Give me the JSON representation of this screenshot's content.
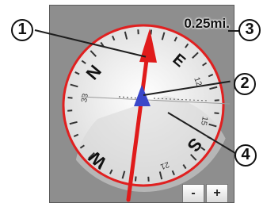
{
  "compass": {
    "cardinals": {
      "north": "N",
      "east": "E",
      "south": "S",
      "west": "W"
    },
    "degree_labels": {
      "d120": "12",
      "d150": "15",
      "d210": "21",
      "d330": "33"
    }
  },
  "distance_to_destination": "0.25mi.",
  "zoom": {
    "out_label": "-",
    "in_label": "+"
  },
  "callouts": [
    "1",
    "2",
    "3",
    "4"
  ]
}
